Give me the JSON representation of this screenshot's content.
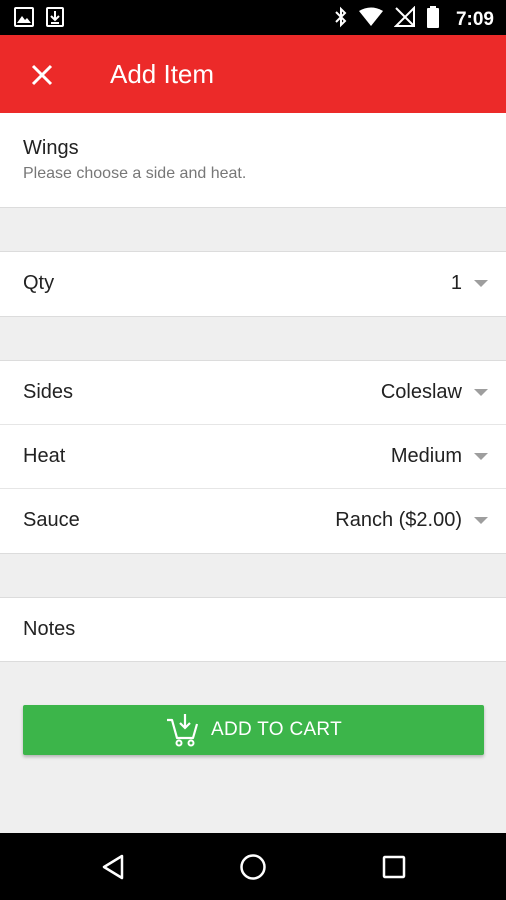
{
  "status_bar": {
    "time": "7:09",
    "icons": [
      "image-icon",
      "download-icon",
      "bluetooth-icon",
      "wifi-icon",
      "no-signal-icon",
      "battery-icon"
    ]
  },
  "app_bar": {
    "title": "Add Item",
    "close_icon": "close-icon",
    "color": "#ec2a29"
  },
  "item": {
    "name": "Wings",
    "description": "Please choose a side and heat."
  },
  "quantity": {
    "label": "Qty",
    "value": "1"
  },
  "options": [
    {
      "label": "Sides",
      "value": "Coleslaw"
    },
    {
      "label": "Heat",
      "value": "Medium"
    },
    {
      "label": "Sauce",
      "value": "Ranch ($2.00)"
    }
  ],
  "notes": {
    "label": "Notes"
  },
  "cart_button": {
    "label": "ADD TO CART",
    "icon": "cart-add-icon",
    "color": "#3cb54a"
  },
  "nav_bar": {
    "icons": [
      "back-icon",
      "home-icon",
      "recents-icon"
    ]
  }
}
